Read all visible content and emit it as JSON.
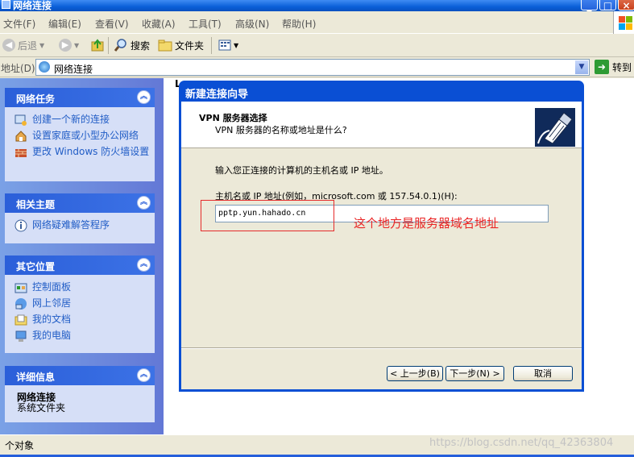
{
  "window": {
    "title": "网络连接"
  },
  "menu": [
    "文件(F)",
    "编辑(E)",
    "查看(V)",
    "收藏(A)",
    "工具(T)",
    "高级(N)",
    "帮助(H)"
  ],
  "toolbar": {
    "back": "后退",
    "search": "搜索",
    "folders": "文件夹"
  },
  "address": {
    "label": "地址(D)",
    "value": "网络连接",
    "go": "转到"
  },
  "tasks": {
    "network_tasks": {
      "title": "网络任务",
      "items": [
        "创建一个新的连接",
        "设置家庭或小型办公网络",
        "更改 Windows 防火墙设置"
      ]
    },
    "related": {
      "title": "相关主题",
      "items": [
        "网络疑难解答程序"
      ]
    },
    "other_places": {
      "title": "其它位置",
      "items": [
        "控制面板",
        "网上邻居",
        "我的文档",
        "我的电脑"
      ]
    },
    "details": {
      "title": "详细信息",
      "name": "网络连接",
      "sub": "系统文件夹"
    }
  },
  "main": {
    "column_header": "L"
  },
  "dialog": {
    "title": "新建连接向导",
    "heading": "VPN 服务器选择",
    "subheading": "VPN 服务器的名称或地址是什么?",
    "instruction": "输入您正连接的计算机的主机名或 IP 地址。",
    "host_label": "主机名或 IP 地址(例如，microsoft.com 或 157.54.0.1)(H):",
    "host_value": "pptp.yun.hahado.cn",
    "annotation": "这个地方是服务器域名地址",
    "buttons": {
      "back": "< 上一步(B)",
      "next": "下一步(N) >",
      "cancel": "取消"
    }
  },
  "status": {
    "text": "个对象",
    "watermark": "https://blog.csdn.net/qq_42363804"
  },
  "colors": {
    "xp_blue": "#0a4fd4",
    "task_link": "#215dc6",
    "annotation_red": "#ea2525"
  }
}
